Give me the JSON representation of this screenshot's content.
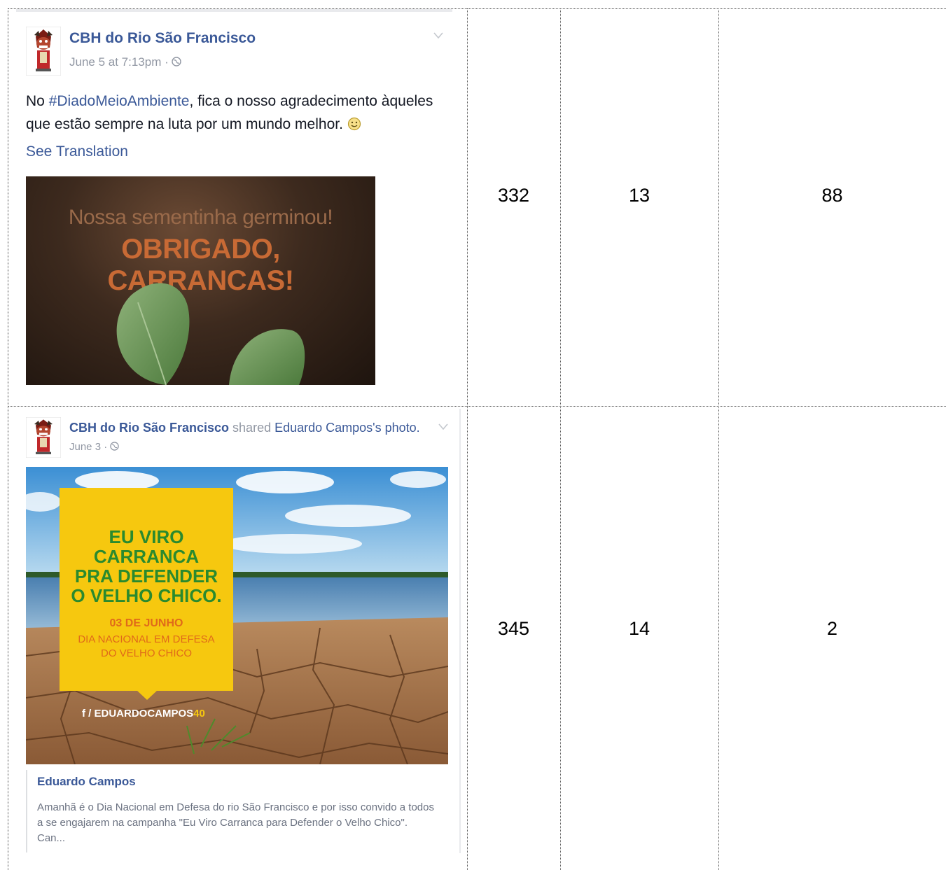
{
  "rows": [
    {
      "post": {
        "page_name": "CBH do Rio São Francisco",
        "timestamp": "June 5 at 7:13pm · ",
        "text_prefix": "No ",
        "hashtag": "#DiadoMeioAmbiente",
        "text_rest": ", fica o nosso agradecimento àqueles que estão sempre na luta por um mundo melhor. ",
        "smiley": "☺",
        "see_translation": "See Translation",
        "image_line1": "Nossa sementinha germinou!",
        "image_line2": "OBRIGADO, CARRANCAS!"
      },
      "col1": "332",
      "col2": "13",
      "col3": "88"
    },
    {
      "post": {
        "page_name": "CBH do Rio São Francisco",
        "shared_word": " shared ",
        "shared_owner": "Eduardo Campos's photo.",
        "timestamp": "June 3 · ",
        "image_title": "EU VIRO CARRANCA PRA DEFENDER O VELHO CHICO.",
        "image_title_lines": [
          "EU VIRO",
          "CARRANCA",
          "PRA DEFENDER",
          "O VELHO CHICO."
        ],
        "image_date": "03 DE JUNHO",
        "image_sub_lines": [
          "DIA NACIONAL EM DEFESA",
          "DO VELHO CHICO"
        ],
        "image_tag": "f / EDUARDOCAMPOS",
        "image_tag_num": "40",
        "shared_name": "Eduardo Campos",
        "shared_desc": "Amanhã é o Dia Nacional em Defesa do rio São Francisco e por isso convido a todos a se engajarem na campanha \"Eu Viro Carranca para Defender o Velho Chico\". Can..."
      },
      "col1": "345",
      "col2": "14",
      "col3": "2"
    }
  ],
  "icons": {
    "globe": "globe-icon",
    "chevron": "chevron-down-icon",
    "smiley": "smiley-icon"
  },
  "colors": {
    "facebook_blue": "#3b5998",
    "meta_grey": "#9197a3",
    "banner_yellow": "#f6c80f",
    "banner_green": "#2a8a2e",
    "banner_orange": "#e06a1a"
  }
}
